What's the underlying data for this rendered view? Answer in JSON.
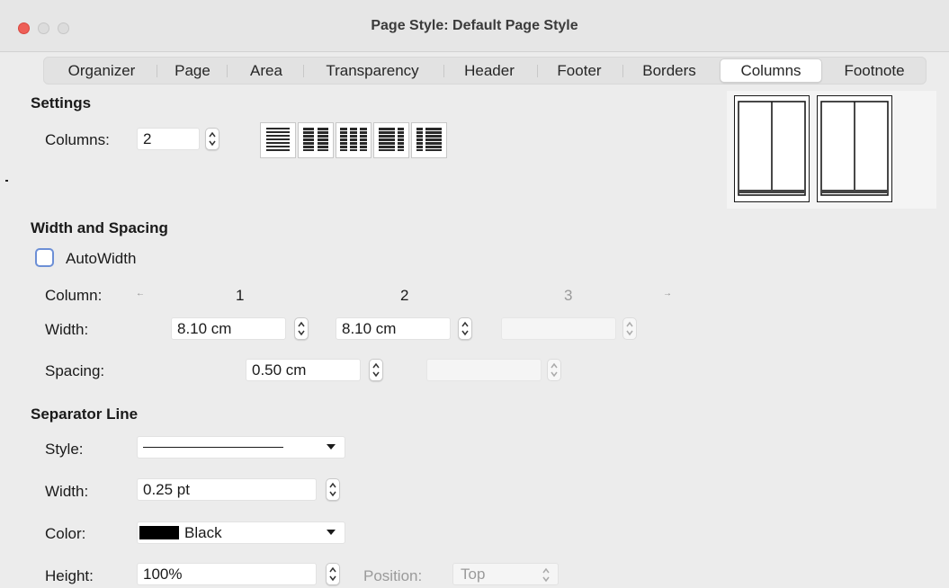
{
  "window": {
    "title": "Page Style: Default Page Style",
    "traffic_lights": {
      "close": "#ee5f57",
      "minimize": "#d2d2d2",
      "zoom": "#d2d2d2"
    }
  },
  "tabs": [
    {
      "label": "Organizer",
      "active": false
    },
    {
      "label": "Page",
      "active": false
    },
    {
      "label": "Area",
      "active": false
    },
    {
      "label": "Transparency",
      "active": false
    },
    {
      "label": "Header",
      "active": false
    },
    {
      "label": "Footer",
      "active": false
    },
    {
      "label": "Borders",
      "active": false
    },
    {
      "label": "Columns",
      "active": true
    },
    {
      "label": "Footnote",
      "active": false
    }
  ],
  "settings": {
    "heading": "Settings",
    "columns_label": "Columns:",
    "columns_value": "2"
  },
  "width_spacing": {
    "heading": "Width and Spacing",
    "autowidth_label": "AutoWidth",
    "autowidth_checked": false,
    "column_label": "Column:",
    "column_numbers": [
      "1",
      "2",
      "3"
    ],
    "width_label": "Width:",
    "width_values": [
      "8.10 cm",
      "8.10 cm",
      ""
    ],
    "spacing_label": "Spacing:",
    "spacing_values": [
      "0.50 cm",
      ""
    ]
  },
  "separator": {
    "heading": "Separator Line",
    "style_label": "Style:",
    "width_label": "Width:",
    "width_value": "0.25 pt",
    "color_label": "Color:",
    "color_value": "Black",
    "color_swatch": "#000000",
    "height_label": "Height:",
    "height_value": "100%",
    "position_label": "Position:",
    "position_value": "Top"
  }
}
